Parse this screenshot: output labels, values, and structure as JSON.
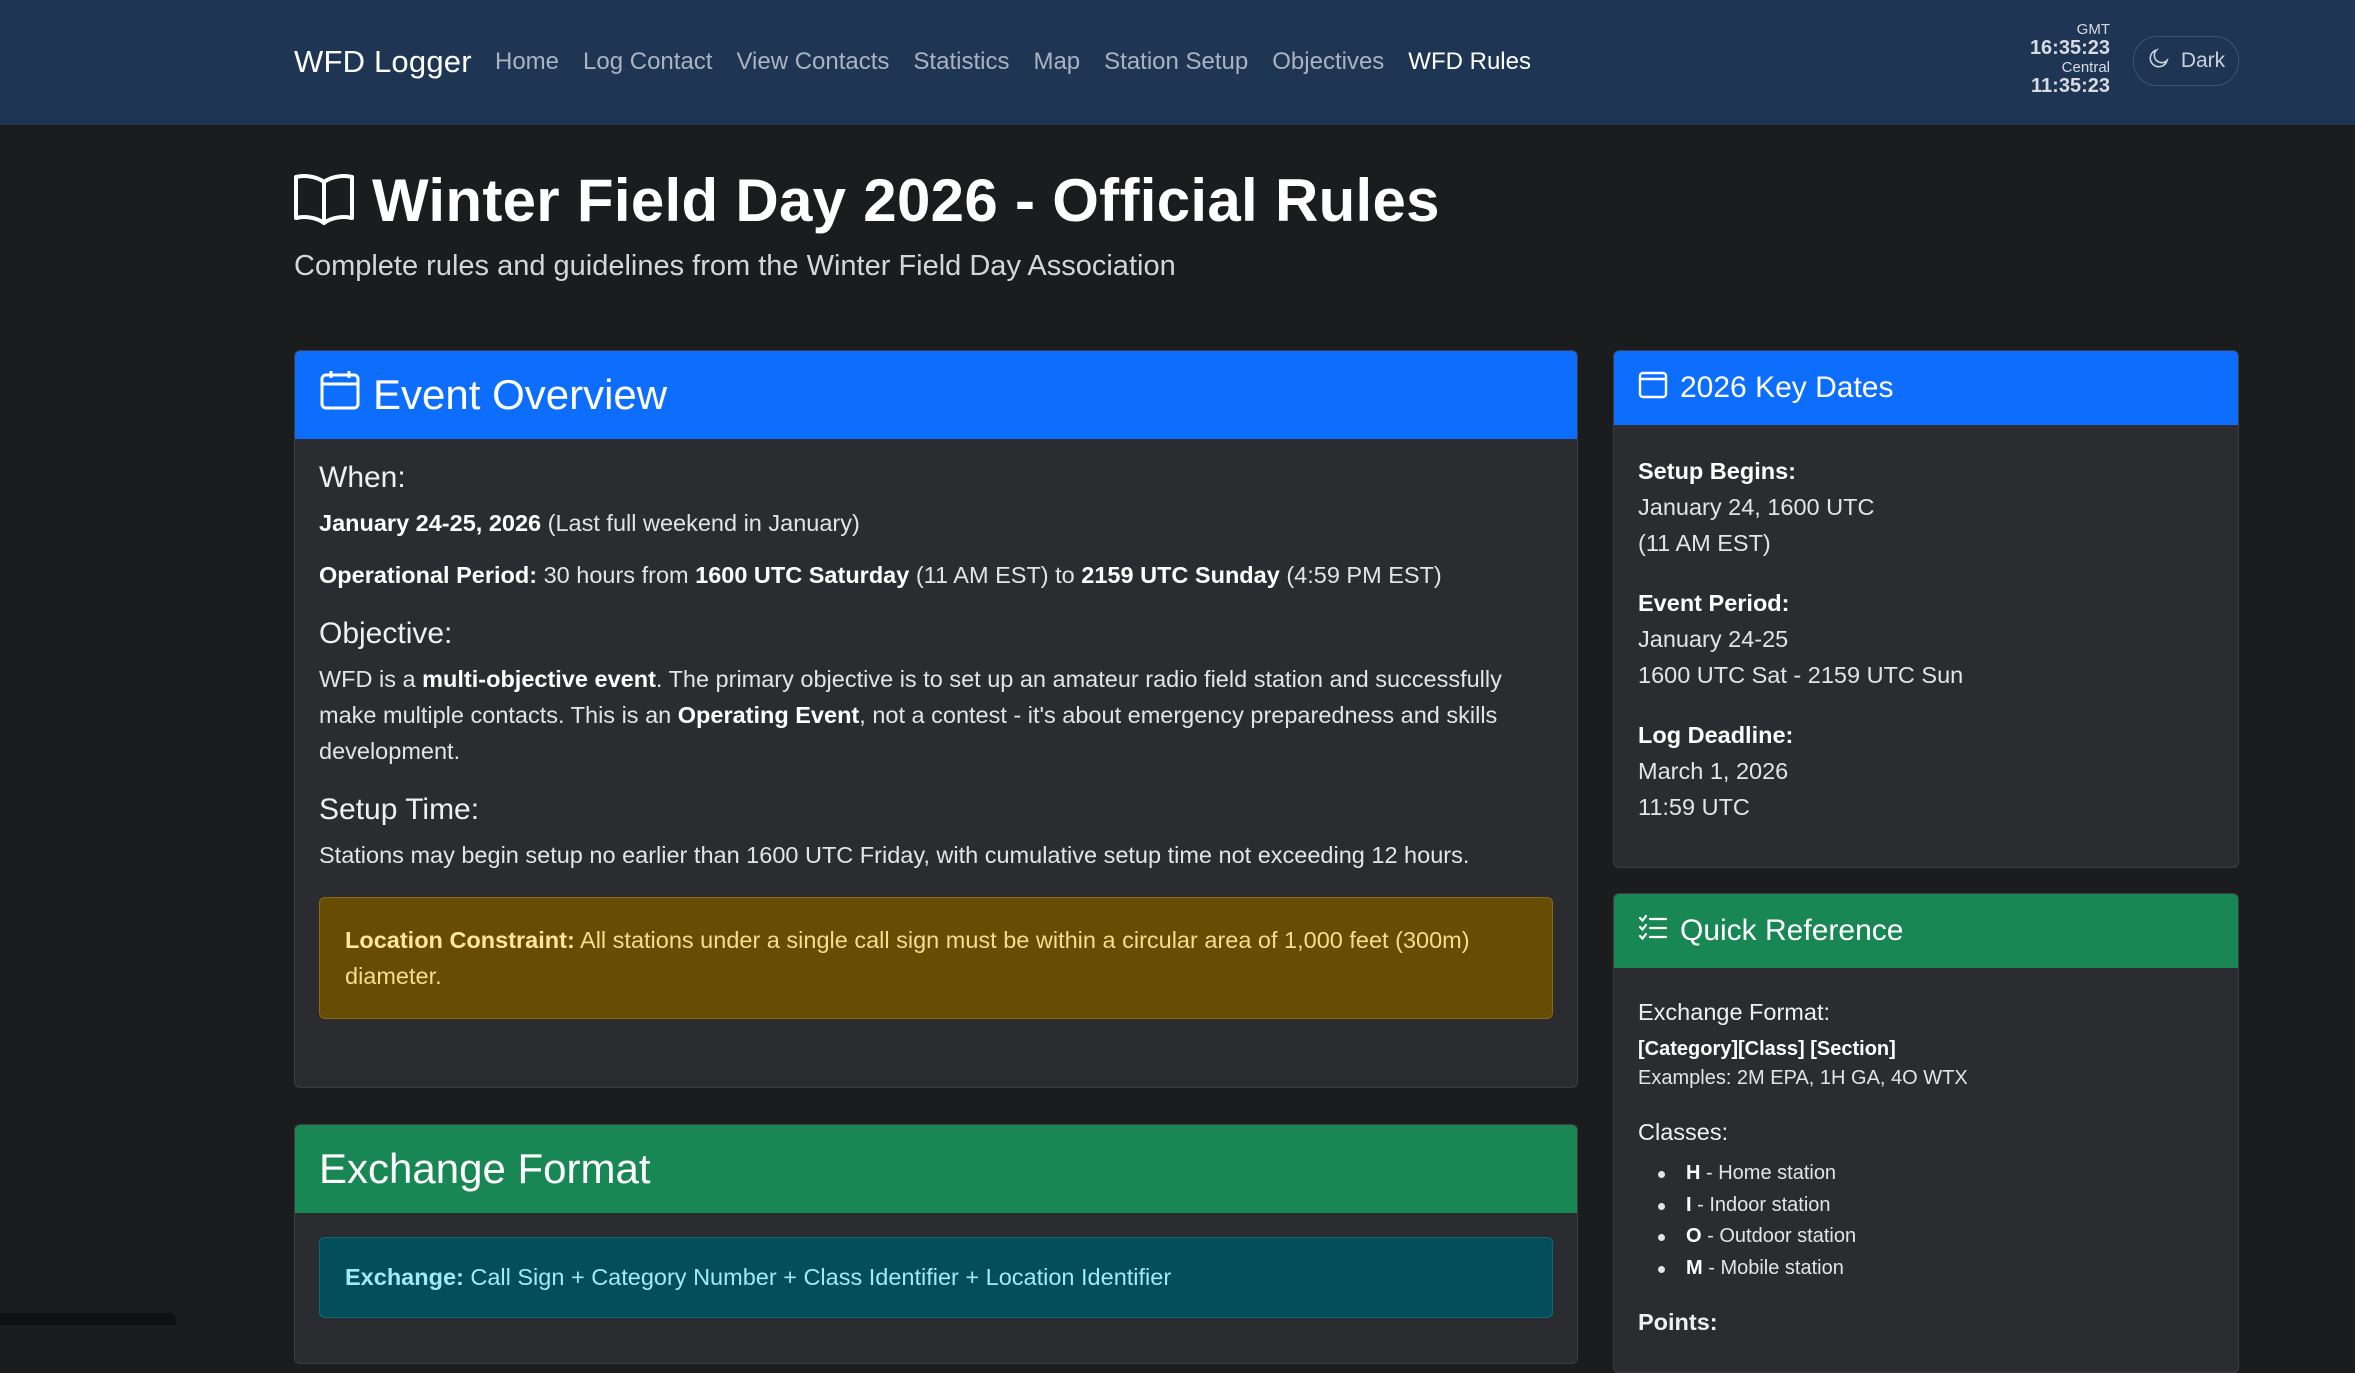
{
  "navbar": {
    "brand": "WFD Logger",
    "links": [
      {
        "label": "Home"
      },
      {
        "label": "Log Contact"
      },
      {
        "label": "View Contacts"
      },
      {
        "label": "Statistics"
      },
      {
        "label": "Map"
      },
      {
        "label": "Station Setup"
      },
      {
        "label": "Objectives"
      },
      {
        "label": "WFD Rules",
        "active": true
      }
    ],
    "clock": {
      "tz1": "GMT",
      "time1": "16:35:23",
      "tz2": "Central",
      "time2": "11:35:23"
    },
    "theme_label": "Dark"
  },
  "header": {
    "title": "Winter Field Day 2026 - Official Rules",
    "subtitle": "Complete rules and guidelines from the Winter Field Day Association"
  },
  "overview": {
    "title": "Event Overview",
    "when_heading": "When:",
    "when_date": "January 24-25, 2026",
    "when_note": " (Last full weekend in January)",
    "op_label": "Operational Period:",
    "op_t1": " 30 hours from ",
    "op_start": "1600 UTC Saturday",
    "op_t2": " (11 AM EST) to ",
    "op_end": "2159 UTC Sunday",
    "op_t3": " (4:59 PM EST)",
    "objective_heading": "Objective:",
    "obj_t1": "WFD is a ",
    "obj_b1": "multi-objective event",
    "obj_t2": ". The primary objective is to set up an amateur radio field station and successfully make multiple contacts. This is an ",
    "obj_b2": "Operating Event",
    "obj_t3": ", not a contest - it's about emergency preparedness and skills development.",
    "setup_heading": "Setup Time:",
    "setup_text": "Stations may begin setup no earlier than 1600 UTC Friday, with cumulative setup time not exceeding 12 hours.",
    "alert_label": "Location Constraint:",
    "alert_text": " All stations under a single call sign must be within a circular area of 1,000 feet (300m) diameter."
  },
  "exchange": {
    "title": "Exchange Format",
    "label": "Exchange:",
    "text": " Call Sign + Category Number + Class Identifier + Location Identifier"
  },
  "keydates": {
    "title": "2026 Key Dates",
    "items": [
      {
        "label": "Setup Begins:",
        "line1": "January 24, 1600 UTC",
        "line2": "(11 AM EST)"
      },
      {
        "label": "Event Period:",
        "line1": "January 24-25",
        "line2": "1600 UTC Sat - 2159 UTC Sun"
      },
      {
        "label": "Log Deadline:",
        "line1": "March 1, 2026",
        "line2": "11:59 UTC"
      }
    ]
  },
  "quickref": {
    "title": "Quick Reference",
    "exchange_label": "Exchange Format:",
    "format": "[Category][Class] [Section]",
    "examples": "Examples: 2M EPA, 1H GA, 4O WTX",
    "classes_label": "Classes:",
    "classes": [
      {
        "code": "H",
        "desc": " - Home station"
      },
      {
        "code": "I",
        "desc": " - Indoor station"
      },
      {
        "code": "O",
        "desc": " - Outdoor station"
      },
      {
        "code": "M",
        "desc": " - Mobile station"
      }
    ],
    "points_label": "Points:"
  },
  "colors": {
    "navbar": "#1f3554",
    "primary": "#0d6efd",
    "success": "#198754",
    "warning_bg": "#664d03",
    "info_bg": "#044e5c"
  }
}
